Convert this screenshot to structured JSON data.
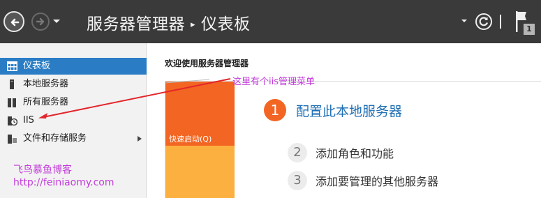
{
  "header": {
    "title_part1": "服务器管理器",
    "title_separator": "▸",
    "title_part2": "仪表板",
    "notification_count": "1"
  },
  "sidebar": {
    "items": [
      {
        "label": "仪表板",
        "icon": "dashboard-icon",
        "active": true
      },
      {
        "label": "本地服务器",
        "icon": "server-icon"
      },
      {
        "label": "所有服务器",
        "icon": "servers-icon"
      },
      {
        "label": "IIS",
        "icon": "iis-icon"
      },
      {
        "label": "文件和存储服务",
        "icon": "file-storage-icon",
        "expandable": true
      }
    ],
    "brand_name": "飞鸟慕鱼博客",
    "brand_url": "http://feiniaomy.com"
  },
  "main": {
    "welcome": "欢迎使用服务器管理器",
    "annotation": "这里有个iis管理菜单",
    "quick_start": "快速启动(Q)",
    "steps": [
      {
        "num": "1",
        "label": "配置此本地服务器"
      },
      {
        "num": "2",
        "label": "添加角色和功能"
      },
      {
        "num": "3",
        "label": "添加要管理的其他服务器"
      }
    ]
  },
  "colors": {
    "header_bg": "#3a3a3a",
    "active_blue": "#2a7dc5",
    "tile_orange": "#f26522",
    "tile_yellow": "#fbb040",
    "link_blue": "#1f6fb5",
    "annotation_magenta": "#c23bd9",
    "arrow_red": "#e3262b"
  }
}
